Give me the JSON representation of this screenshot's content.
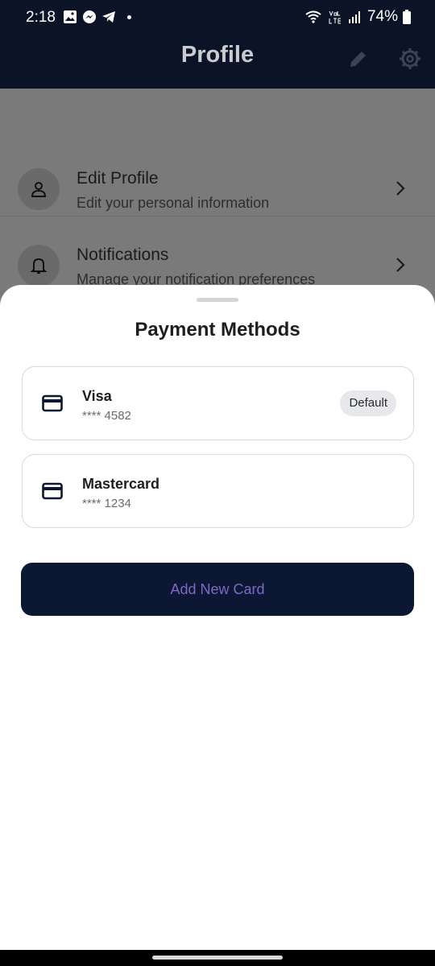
{
  "status_bar": {
    "time": "2:18",
    "battery": "74%",
    "icons": [
      "gallery-icon",
      "messenger-icon",
      "telegram-icon",
      "dot-icon",
      "wifi-icon",
      "volte-icon",
      "signal-icon",
      "battery-icon"
    ]
  },
  "app_bar": {
    "title": "Profile",
    "icons": [
      "edit-icon",
      "settings-icon"
    ]
  },
  "background_menu": [
    {
      "title": "Edit Profile",
      "subtitle": "Edit your personal information",
      "icon": "person-icon"
    },
    {
      "title": "Notifications",
      "subtitle": "Manage your notification preferences",
      "icon": "bell-icon"
    }
  ],
  "sheet": {
    "title": "Payment Methods",
    "cards": [
      {
        "name": "Visa",
        "number": "**** 4582",
        "badge": "Default",
        "icon": "credit-card-icon"
      },
      {
        "name": "Mastercard",
        "number": "**** 1234",
        "icon": "credit-card-icon"
      }
    ],
    "add_button": "Add New Card"
  },
  "colors": {
    "app_bar_bg": "#0b1326",
    "button_bg": "#0b1733",
    "button_text": "#7f68c7",
    "badge_bg": "#e6e8ec"
  }
}
